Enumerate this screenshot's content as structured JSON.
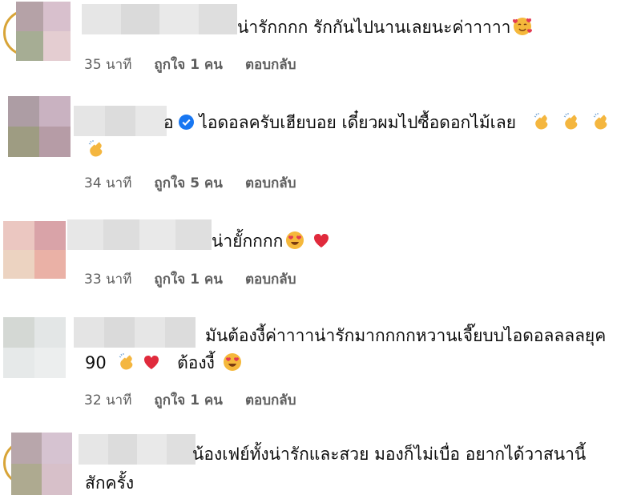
{
  "comments": [
    {
      "text": "น่ารักกกก รักกันไปนานเลยนะค่าาาาา",
      "emojis": [
        "smiling-face-with-hearts"
      ],
      "time": "35 นาที",
      "likes": "ถูกใจ 1 คน",
      "reply": "ตอบกลับ"
    },
    {
      "text": "ไอดอลครับเฮียบอย เดี๋ยวผมไปซื้อดอกไม้เลย",
      "emojis": [
        "clapping-hands",
        "clapping-hands",
        "clapping-hands",
        "clapping-hands"
      ],
      "verified": true,
      "time": "34 นาที",
      "likes": "ถูกใจ 5 คน",
      "reply": "ตอบกลับ"
    },
    {
      "text": "น่ายั้กกกก",
      "emojis": [
        "smiling-face-with-heart-eyes",
        "red-heart"
      ],
      "time": "33 นาที",
      "likes": "ถูกใจ 1 คน",
      "reply": "ตอบกลับ"
    },
    {
      "text": "มันต้องงี้ค่าาาาน่ารักมากกกกหวานเจี๊ยบบไอดอลลลลยุค",
      "text_line2_a": "90",
      "text_line2_b": "ต้องงี้",
      "emojis": [
        "clapping-hands",
        "red-heart",
        "smiling-face-with-heart-eyes"
      ],
      "time": "32 นาที",
      "likes": "ถูกใจ 1 คน",
      "reply": "ตอบกลับ"
    },
    {
      "text": "น้องเฟย์ทั้งน่ารักและสวย มองก็ไม่เบื่อ อยากได้วาสนานี้",
      "text_line2": "สักครั้ง"
    }
  ],
  "colors": {
    "verified": "#1877f2",
    "meta": "#5f5f5f",
    "story_ring": "#d8a437"
  }
}
